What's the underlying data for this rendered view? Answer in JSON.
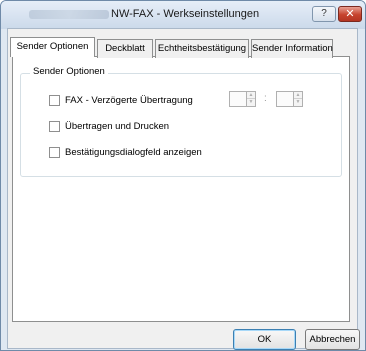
{
  "window": {
    "title": "NW-FAX - Werkseinstellungen",
    "help_label": "?",
    "close_label": "✕"
  },
  "tabs": [
    {
      "label": "Sender Optionen",
      "active": true
    },
    {
      "label": "Deckblatt",
      "active": false
    },
    {
      "label": "Echtheitsbestätigung",
      "active": false
    },
    {
      "label": "Sender Information",
      "active": false
    }
  ],
  "group": {
    "title": "Sender Optionen",
    "options": [
      {
        "label": "FAX - Verzögerte Übertragung",
        "checked": false
      },
      {
        "label": "Übertragen und Drucken",
        "checked": false
      },
      {
        "label": "Bestätigungsdialogfeld anzeigen",
        "checked": false
      }
    ],
    "time_separator": ":",
    "hour_value": "",
    "minute_value": ""
  },
  "buttons": {
    "ok": "OK",
    "cancel": "Abbrechen"
  },
  "colors": {
    "title_bar": "#cbd9ea",
    "close_button": "#c6432e",
    "panel": "#ffffff",
    "window_face": "#f0f0f0"
  }
}
